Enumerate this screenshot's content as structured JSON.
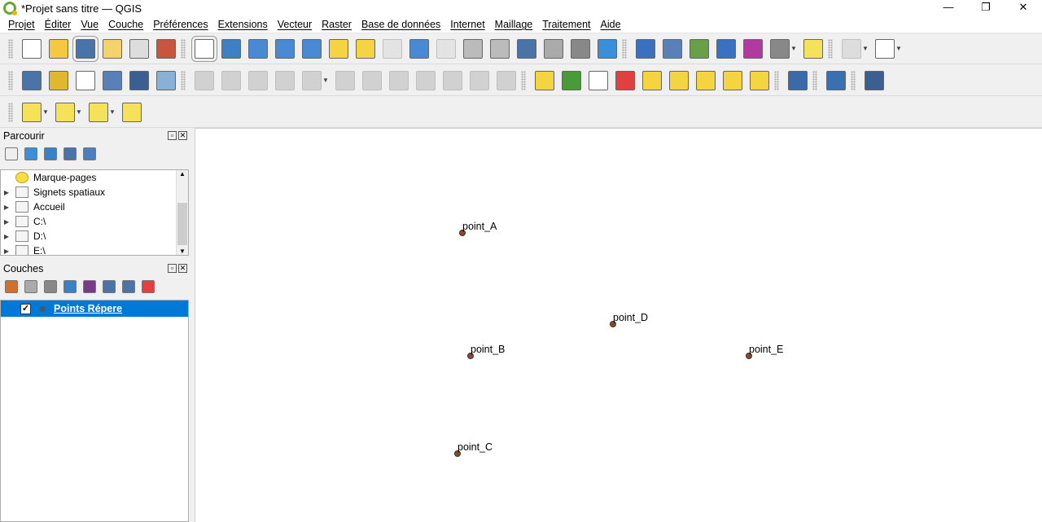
{
  "window": {
    "title": "*Projet sans titre — QGIS",
    "minimize": "—",
    "restore": "❐",
    "close": "✕"
  },
  "menu": [
    "Projet",
    "Éditer",
    "Vue",
    "Couche",
    "Préférences",
    "Extensions",
    "Vecteur",
    "Raster",
    "Base de données",
    "Internet",
    "Maillage",
    "Traitement",
    "Aide"
  ],
  "toolbars": [
    [
      [
        "grip"
      ],
      [
        "new-project-icon",
        "#fff"
      ],
      [
        "open-project-icon",
        "#f5c842"
      ],
      [
        "save-project-icon",
        "#4a74a8",
        "active"
      ],
      [
        "new-print-layout-icon",
        "#f3d36b"
      ],
      [
        "layout-manager-icon",
        "#ddd"
      ],
      [
        "style-manager-icon",
        "#c8553d"
      ],
      [
        "grip"
      ],
      [
        "pan-icon",
        "#fff",
        "active"
      ],
      [
        "pan-to-selection-icon",
        "#3f7fc4"
      ],
      [
        "zoom-in-icon",
        "#4a8ad4"
      ],
      [
        "zoom-out-icon",
        "#4a8ad4"
      ],
      [
        "zoom-full-icon",
        "#4a8ad4"
      ],
      [
        "zoom-to-selection-icon",
        "#f5d442"
      ],
      [
        "zoom-to-layer-icon",
        "#f5d442"
      ],
      [
        "zoom-native-icon",
        "#ccc",
        "dis"
      ],
      [
        "zoom-last-icon",
        "#4a8ad4"
      ],
      [
        "zoom-next-icon",
        "#ccc",
        "dis"
      ],
      [
        "new-map-view-icon",
        "#bbb"
      ],
      [
        "new-3d-view-icon",
        "#bbb"
      ],
      [
        "spatial-bookmark-icon",
        "#4a74a8"
      ],
      [
        "show-bookmarks-icon",
        "#aaa"
      ],
      [
        "temporal-controller-icon",
        "#888"
      ],
      [
        "refresh-icon",
        "#3a8fd8"
      ],
      [
        "grip"
      ],
      [
        "identify-icon",
        "#3a70c0"
      ],
      [
        "attribute-table-icon",
        "#5a80b8"
      ],
      [
        "statistics-icon",
        "#6a9f4a"
      ],
      [
        "settings-gear-icon",
        "#3a70c0"
      ],
      [
        "sum-icon",
        "#b03aa0"
      ],
      [
        "measure-icon",
        "#888"
      ],
      [
        "dd"
      ],
      [
        "map-tips-icon",
        "#f5e25a"
      ],
      [
        "grip"
      ],
      [
        "select-radius-icon",
        "#bbb",
        "dis"
      ],
      [
        "dd"
      ],
      [
        "text-annotation-icon",
        "#fff"
      ],
      [
        "dd"
      ]
    ],
    [
      [
        "grip"
      ],
      [
        "data-source-manager-icon",
        "#4a74a8"
      ],
      [
        "new-geopackage-icon",
        "#e0b830"
      ],
      [
        "new-shapefile-icon",
        "#fff"
      ],
      [
        "new-spatialite-icon",
        "#5a80b8"
      ],
      [
        "new-virtual-layer-icon",
        "#3a5f90"
      ],
      [
        "new-temp-layer-icon",
        "#8ab0d8"
      ],
      [
        "grip"
      ],
      [
        "current-edits-icon",
        "#999",
        "dis"
      ],
      [
        "toggle-editing-icon",
        "#999",
        "dis"
      ],
      [
        "save-edits-icon",
        "#999",
        "dis"
      ],
      [
        "add-point-icon",
        "#999",
        "dis"
      ],
      [
        "vertex-tool-icon",
        "#999",
        "dis"
      ],
      [
        "dd"
      ],
      [
        "modify-attributes-icon",
        "#999",
        "dis"
      ],
      [
        "delete-selected-icon",
        "#999",
        "dis"
      ],
      [
        "cut-icon",
        "#999",
        "dis"
      ],
      [
        "copy-icon",
        "#999",
        "dis"
      ],
      [
        "paste-icon",
        "#999",
        "dis"
      ],
      [
        "undo-icon",
        "#999",
        "dis"
      ],
      [
        "redo-icon",
        "#999",
        "dis"
      ],
      [
        "grip"
      ],
      [
        "label-toolbar-icon",
        "#f5d442"
      ],
      [
        "diagram-icon",
        "#4a9a3a"
      ],
      [
        "layer-labeling-icon",
        "#fff"
      ],
      [
        "label-pin-icon",
        "#e04040"
      ],
      [
        "pin-label-icon",
        "#f5d442"
      ],
      [
        "show-hide-label-icon",
        "#f5d442"
      ],
      [
        "move-label-icon",
        "#f5d442"
      ],
      [
        "rotate-label-icon",
        "#f5d442"
      ],
      [
        "change-label-icon",
        "#f5d442"
      ],
      [
        "grip"
      ],
      [
        "metasearch-icon",
        "#3a6aa8"
      ],
      [
        "grip"
      ],
      [
        "python-console-icon",
        "#3a70b0"
      ],
      [
        "grip"
      ],
      [
        "help-icon",
        "#3a5f90"
      ]
    ],
    [
      [
        "grip"
      ],
      [
        "select-features-icon",
        "#f5e25a"
      ],
      [
        "dd"
      ],
      [
        "select-by-attribute-icon",
        "#f5e25a"
      ],
      [
        "dd"
      ],
      [
        "deselect-all-icon",
        "#f5e25a"
      ],
      [
        "dd"
      ],
      [
        "select-by-location-icon",
        "#f5e25a"
      ]
    ]
  ],
  "browser": {
    "title": "Parcourir",
    "tools": [
      [
        "add-layer-icon",
        "#eee"
      ],
      [
        "refresh-icon",
        "#3a8fd8"
      ],
      [
        "filter-icon",
        "#3a80c8"
      ],
      [
        "collapse-all-icon",
        "#4a74a8"
      ],
      [
        "info-icon",
        "#4a80c0"
      ]
    ],
    "items": [
      {
        "label": "Marque-pages",
        "icon": "star-icon",
        "expand": false
      },
      {
        "label": "Signets spatiaux",
        "icon": "bookmark-icon",
        "expand": true
      },
      {
        "label": "Accueil",
        "icon": "home-icon",
        "expand": true
      },
      {
        "label": "C:\\",
        "icon": "folder-icon",
        "expand": true
      },
      {
        "label": "D:\\",
        "icon": "folder-icon",
        "expand": true
      },
      {
        "label": "E:\\",
        "icon": "folder-icon",
        "expand": true
      }
    ]
  },
  "layers_panel": {
    "title": "Couches",
    "tools": [
      [
        "style-icon",
        "#d07030"
      ],
      [
        "add-group-icon",
        "#aaa"
      ],
      [
        "visibility-icon",
        "#888"
      ],
      [
        "filter-icon",
        "#3a80c8"
      ],
      [
        "expression-filter-icon",
        "#7a3a8a"
      ],
      [
        "expand-all-icon",
        "#4a74a8"
      ],
      [
        "collapse-all-icon",
        "#4a74a8"
      ],
      [
        "remove-layer-icon",
        "#e04040"
      ]
    ],
    "layers": [
      {
        "name": "Points Répere",
        "checked": true
      }
    ]
  },
  "map": {
    "points": [
      "point_A",
      "point_B",
      "point_C",
      "point_D",
      "point_E"
    ],
    "point_color": "#8b4a2b"
  }
}
